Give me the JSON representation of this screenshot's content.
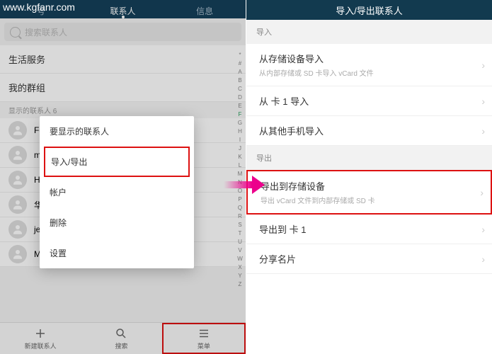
{
  "url": "www.kgfanr.com",
  "left": {
    "tabs": {
      "t1": "号",
      "t2": "联系人",
      "t3": "信息"
    },
    "search_ph": "搜索联系人",
    "sec1": "生活服务",
    "sec2": "我的群组",
    "shown": "显示的联系人 6",
    "contacts": {
      "c0": "Fg",
      "c1": "m",
      "c2": "Hl",
      "c3": "华",
      "c4": "je",
      "c5": "Mary"
    },
    "alpha": [
      "*",
      "#",
      "A",
      "B",
      "C",
      "D",
      "E",
      "F",
      "G",
      "H",
      "I",
      "J",
      "K",
      "L",
      "M",
      "N",
      "O",
      "P",
      "Q",
      "R",
      "S",
      "T",
      "U",
      "V",
      "W",
      "X",
      "Y",
      "Z"
    ],
    "bottom": {
      "b1": "新建联系人",
      "b2": "搜索",
      "b3": "菜单"
    },
    "popup": {
      "title": "要显示的联系人",
      "i1": "导入/导出",
      "i2": "帐户",
      "i3": "删除",
      "i4": "设置"
    }
  },
  "right": {
    "title": "导入/导出联系人",
    "sec_import": "导入",
    "r1": {
      "t": "从存储设备导入",
      "s": "从内部存储或 SD 卡导入 vCard 文件"
    },
    "r2": {
      "t": "从 卡 1 导入"
    },
    "r3": {
      "t": "从其他手机导入"
    },
    "sec_export": "导出",
    "r4": {
      "t": "导出到存储设备",
      "s": "导出 vCard 文件到内部存储或 SD 卡"
    },
    "r5": {
      "t": "导出到 卡 1"
    },
    "r6": {
      "t": "分享名片"
    }
  }
}
